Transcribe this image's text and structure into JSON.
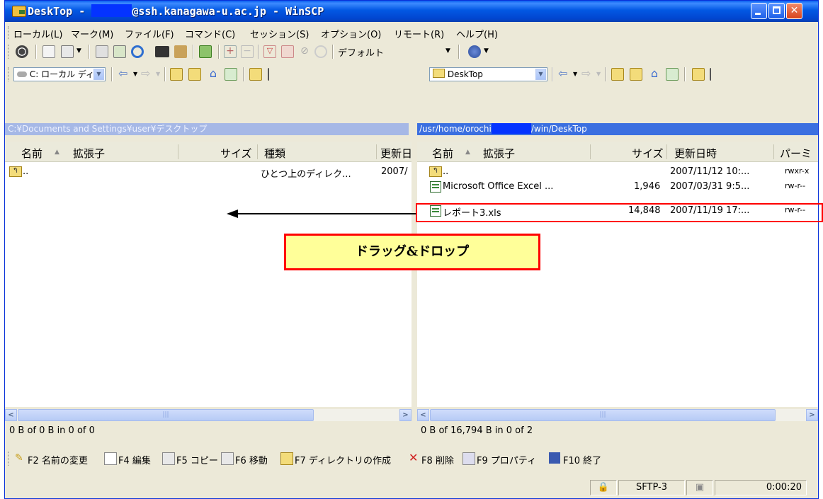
{
  "window": {
    "title_left": "DeskTop - ",
    "title_right": "@ssh.kanagawa-u.ac.jp - WinSCP"
  },
  "menu": [
    "ローカル(L)",
    "マーク(M)",
    "ファイル(F)",
    "コマンド(C)",
    "セッション(S)",
    "オプション(O)",
    "リモート(R)",
    "ヘルプ(H)"
  ],
  "toolbar": {
    "preset_label": "デフォルト"
  },
  "local": {
    "drive_label": "C: ローカル ディ",
    "path": "C:¥Documents and Settings¥user¥デスクトップ",
    "headers": [
      "名前",
      "拡張子",
      "サイズ",
      "種類",
      "更新日"
    ],
    "rows": [
      {
        "name": "..",
        "type": "ひとつ上のディレク...",
        "date": "2007/"
      }
    ],
    "status": "0 B of 0 B in 0 of 0"
  },
  "remote": {
    "dir_label": "DeskTop",
    "path_prefix": "/usr/home/orochi",
    "path_suffix": "/win/DeskTop",
    "headers": [
      "名前",
      "拡張子",
      "サイズ",
      "更新日時",
      "パーミ"
    ],
    "rows": [
      {
        "name": "..",
        "size": "",
        "date": "2007/11/12 10:...",
        "perm": "rwxr-x"
      },
      {
        "name": "Microsoft Office Excel ...",
        "size": "1,946",
        "date": "2007/03/31 9:5...",
        "perm": "rw-r--"
      },
      {
        "name": "レポート3.xls",
        "size": "14,848",
        "date": "2007/11/19 17:...",
        "perm": "rw-r--"
      }
    ],
    "status": "0 B of 16,794 B in 0 of 2"
  },
  "fkeys": [
    "F2 名前の変更",
    "F4 編集",
    "F5 コピー",
    "F6 移動",
    "F7 ディレクトリの作成",
    "F8 削除",
    "F9 プロパティ",
    "F10 終了"
  ],
  "statusbar": {
    "protocol": "SFTP-3",
    "elapsed": "0:00:20"
  },
  "annotation": {
    "label": "ドラッグ&ドロップ"
  }
}
